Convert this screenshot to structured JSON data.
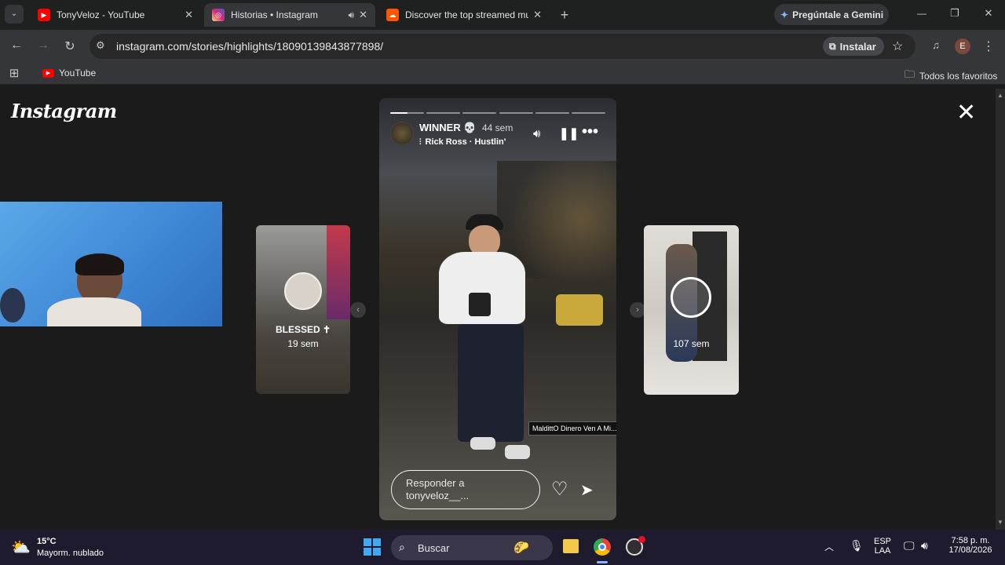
{
  "tabs": [
    {
      "title": "TonyVeloz - YouTube",
      "favicon": "youtube-icon",
      "color": "#ff0000"
    },
    {
      "title": "Historias • Instagram",
      "favicon": "instagram-icon",
      "color": "#d62976",
      "active": true
    },
    {
      "title": "Discover the top streamed mus",
      "favicon": "soundcloud-icon",
      "color": "#ff5500"
    }
  ],
  "gemini_label": "Pregúntale a Gemini",
  "url": "instagram.com/stories/highlights/18090139843877898/",
  "install_label": "Instalar",
  "profile_initial": "E",
  "bookmarks": {
    "youtube": "YouTube",
    "all_favorites": "Todos los favoritos"
  },
  "instagram": {
    "logo": "Instagram",
    "story": {
      "username": "WINNER 💀",
      "time_ago": "44 sem",
      "music": "Rick Ross · Hustlin'",
      "sticker_text": "MaldittO Dinero Ven A Mi...",
      "reply_placeholder": "Responder a tonyveloz__...",
      "progress_segments": 6,
      "progress_current": 1,
      "progress_fraction": 0.5
    },
    "prev_story": {
      "title": "BLESSED ✝",
      "time_ago": "19 sem"
    },
    "next_story": {
      "time_ago": "107 sem"
    }
  },
  "weather": {
    "temp": "15°C",
    "desc": "Mayorm. nublado"
  },
  "search_label": "Buscar",
  "tray": {
    "lang1": "ESP",
    "lang2": "LAA",
    "time": "7:58 p. m.",
    "date": "17/08/2026"
  }
}
